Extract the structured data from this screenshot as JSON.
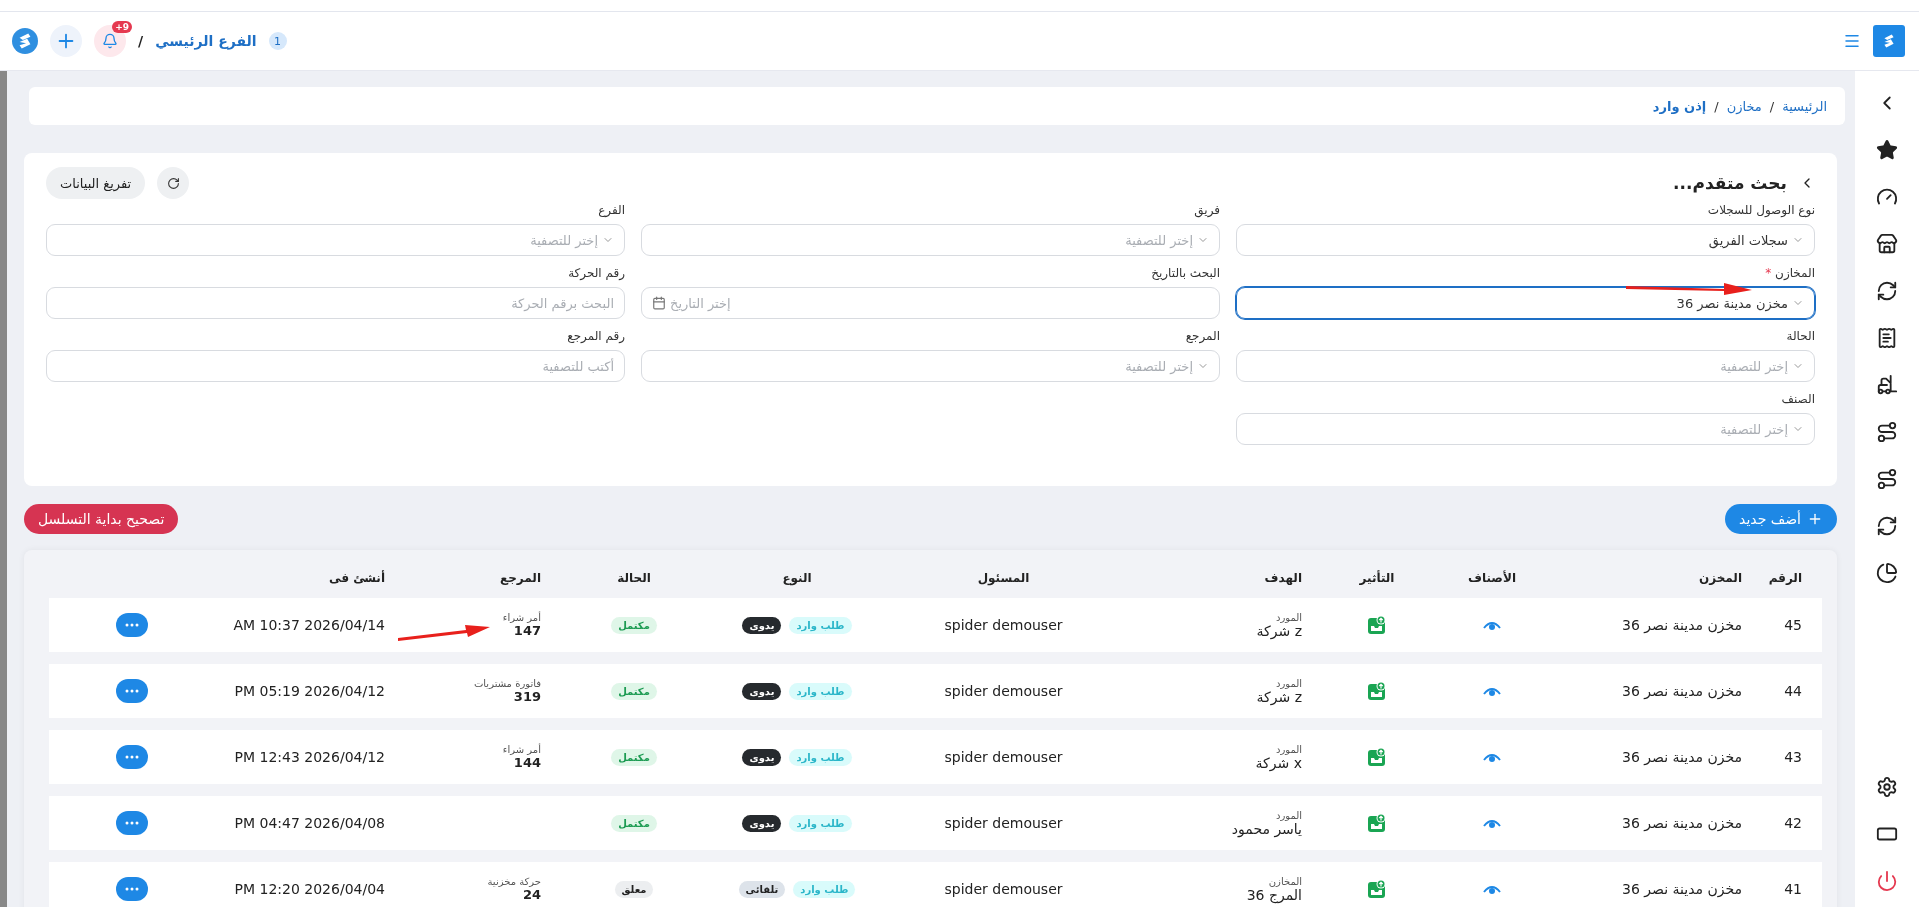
{
  "header": {
    "branch_count": "1",
    "branch_name": "الفرع الرئيسي",
    "separator": "/",
    "notification_badge": "+9"
  },
  "breadcrumb": {
    "separator": "/",
    "items": [
      {
        "label": "الرئيسية",
        "current": false
      },
      {
        "label": "مخازن",
        "current": false
      },
      {
        "label": "إذن وارد",
        "current": true
      }
    ]
  },
  "search_panel": {
    "title": "بحث متقدم...",
    "clear_button": "تفريغ البيانات",
    "required_marker": "*",
    "fields": [
      {
        "label": "نوع الوصول للسجلات",
        "kind": "select",
        "value": "سجلات الفريق",
        "required": false,
        "focused": false
      },
      {
        "label": "فريق",
        "kind": "select",
        "placeholder": "إختر للتصفية",
        "required": false,
        "focused": false
      },
      {
        "label": "الفرع",
        "kind": "select",
        "placeholder": "إختر للتصفية",
        "required": false,
        "focused": false
      },
      {
        "label": "المخازن",
        "kind": "select",
        "value": "مخزن مدينة نصر 36",
        "required": true,
        "focused": true
      },
      {
        "label": "البحث بالتاريخ",
        "kind": "date",
        "placeholder": "إختر التاريخ",
        "required": false,
        "focused": false
      },
      {
        "label": "رقم الحركة",
        "kind": "text",
        "placeholder": "البحث برقم الحركة",
        "required": false,
        "focused": false
      },
      {
        "label": "الحالة",
        "kind": "select",
        "placeholder": "إختر للتصفية",
        "required": false,
        "focused": false
      },
      {
        "label": "المرجع",
        "kind": "select",
        "placeholder": "إختر للتصفية",
        "required": false,
        "focused": false
      },
      {
        "label": "رقم المرجع",
        "kind": "text",
        "placeholder": "أكتب للتصفية",
        "required": false,
        "focused": false
      },
      {
        "label": "الصنف",
        "kind": "select",
        "placeholder": "إختر للتصفية",
        "required": false,
        "focused": false
      }
    ]
  },
  "actions": {
    "add_button": "أضف جديد",
    "reset_button": "تصحيح بداية التسلسل"
  },
  "table": {
    "columns": [
      "الرقم",
      "المخزن",
      "الأصناف",
      "التأثير",
      "الهدف",
      "المسئول",
      "النوع",
      "الحالة",
      "المرجع",
      "أنشئ فى"
    ],
    "rows": [
      {
        "number": "45",
        "warehouse": "مخزن مدينة نصر 36",
        "target": {
          "label": "المورد",
          "value": "شركة z"
        },
        "responsible": "spider demouser",
        "tags": [
          {
            "text": "طلب وارد",
            "kind": "direction"
          },
          {
            "text": "يدوى",
            "kind": "manual"
          }
        ],
        "status": {
          "text": "مكتمل",
          "kind": "complete"
        },
        "reference": {
          "label": "أمر شراء",
          "number": "147"
        },
        "created": "AM 10:37 2026/04/14"
      },
      {
        "number": "44",
        "warehouse": "مخزن مدينة نصر 36",
        "target": {
          "label": "المورد",
          "value": "شركة z"
        },
        "responsible": "spider demouser",
        "tags": [
          {
            "text": "طلب وارد",
            "kind": "direction"
          },
          {
            "text": "يدوى",
            "kind": "manual"
          }
        ],
        "status": {
          "text": "مكتمل",
          "kind": "complete"
        },
        "reference": {
          "label": "فاتورة مشتريات",
          "number": "319"
        },
        "created": "PM 05:19 2026/04/12"
      },
      {
        "number": "43",
        "warehouse": "مخزن مدينة نصر 36",
        "target": {
          "label": "المورد",
          "value": "شركة x"
        },
        "responsible": "spider demouser",
        "tags": [
          {
            "text": "طلب وارد",
            "kind": "direction"
          },
          {
            "text": "يدوى",
            "kind": "manual"
          }
        ],
        "status": {
          "text": "مكتمل",
          "kind": "complete"
        },
        "reference": {
          "label": "أمر شراء",
          "number": "144"
        },
        "created": "PM 12:43 2026/04/12"
      },
      {
        "number": "42",
        "warehouse": "مخزن مدينة نصر 36",
        "target": {
          "label": "المورد",
          "value": "ياسر محمود"
        },
        "responsible": "spider demouser",
        "tags": [
          {
            "text": "طلب وارد",
            "kind": "direction"
          },
          {
            "text": "يدوى",
            "kind": "manual"
          }
        ],
        "status": {
          "text": "مكتمل",
          "kind": "complete"
        },
        "created": "PM 04:47 2026/04/08"
      },
      {
        "number": "41",
        "warehouse": "مخزن مدينة نصر 36",
        "target": {
          "label": "المخازن",
          "value": "المرج 36"
        },
        "responsible": "spider demouser",
        "tags": [
          {
            "text": "طلب وارد",
            "kind": "direction"
          },
          {
            "text": "تلقائى",
            "kind": "auto"
          }
        ],
        "status": {
          "text": "معلق",
          "kind": "pending"
        },
        "reference": {
          "label": "حركة مخزنية",
          "number": "24"
        },
        "created": "PM 12:20 2026/04/04"
      }
    ]
  }
}
